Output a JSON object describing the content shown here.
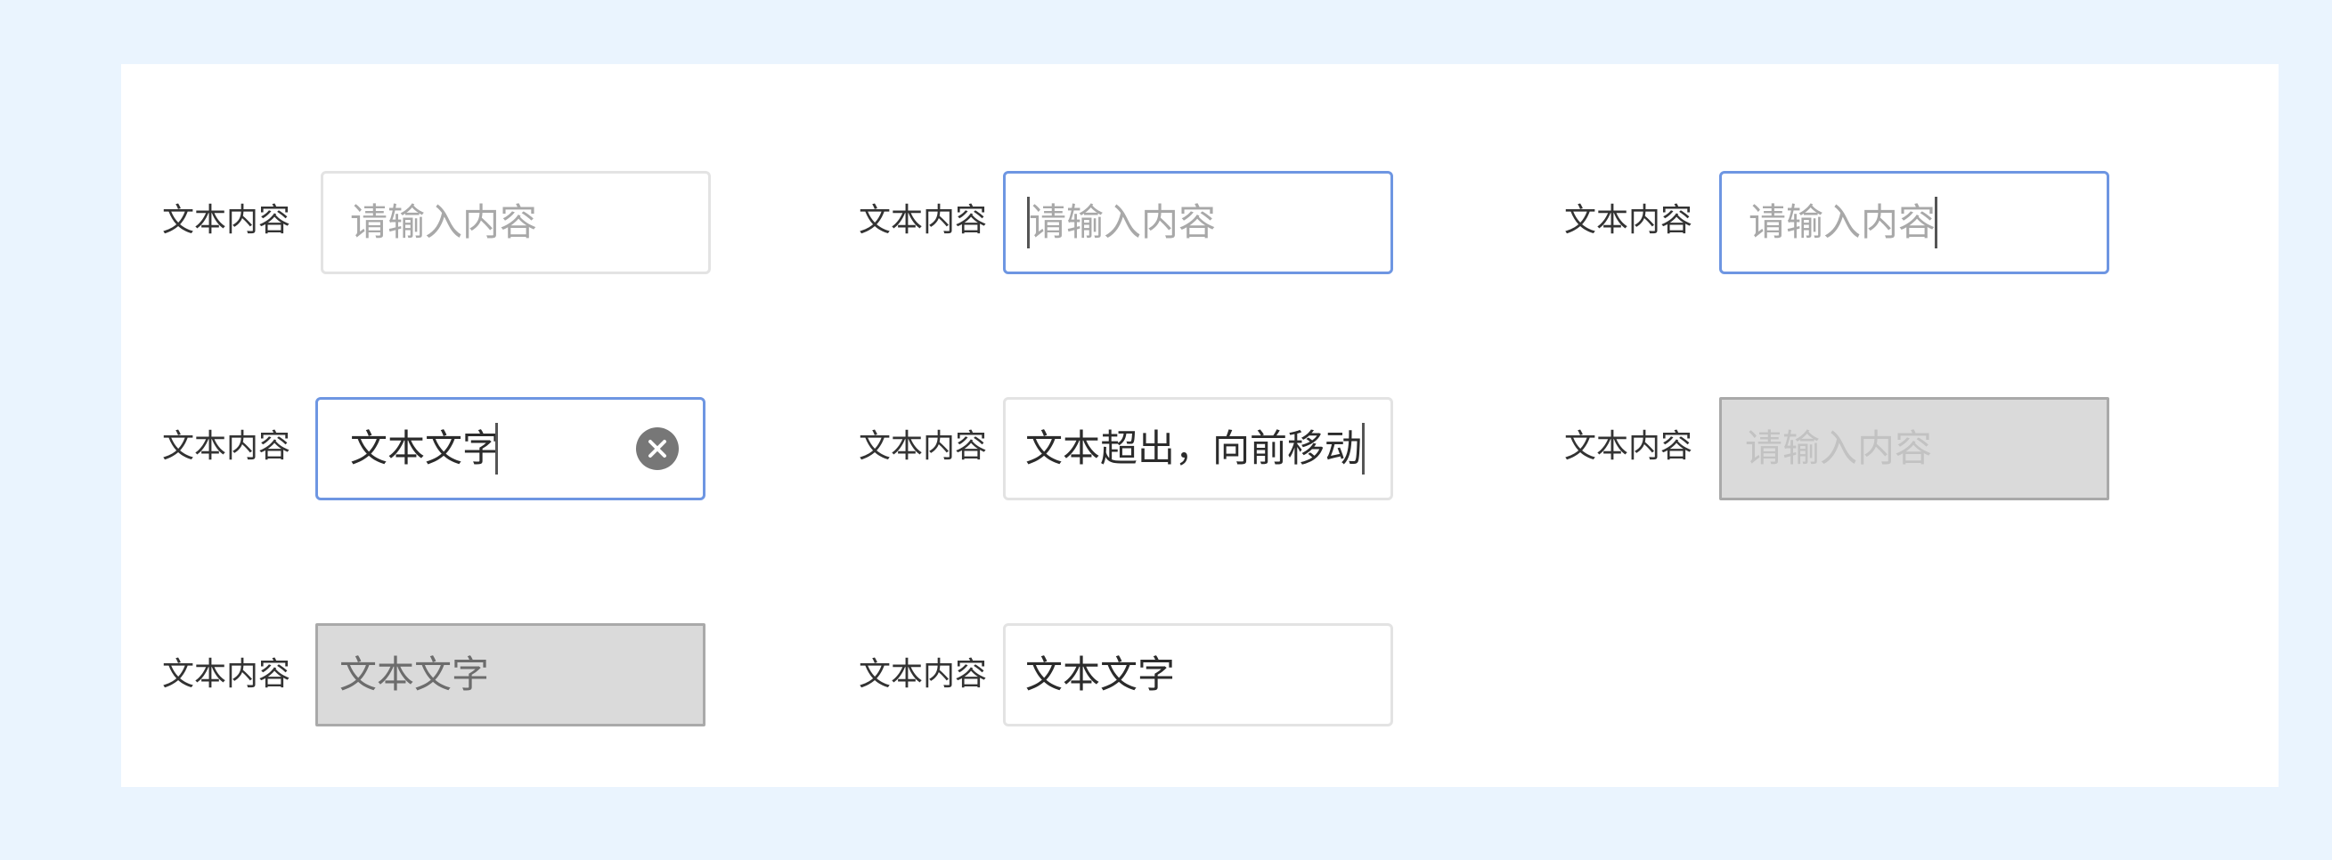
{
  "labels": {
    "r1c1": "文本内容",
    "r1c2": "文本内容",
    "r1c3": "文本内容",
    "r2c1": "文本内容",
    "r2c2": "文本内容",
    "r2c3": "文本内容",
    "r3c1": "文本内容",
    "r3c2": "文本内容"
  },
  "fields": {
    "default": {
      "placeholder": "请输入内容",
      "value": ""
    },
    "focused_caret_start": {
      "placeholder": "请输入内容",
      "value": ""
    },
    "focused_caret_end": {
      "placeholder": "请输入内容",
      "value": ""
    },
    "typing_with_clear": {
      "placeholder": "",
      "value": "文本文字"
    },
    "overflow": {
      "placeholder": "",
      "value": "文本超出，向前移动"
    },
    "disabled_empty": {
      "placeholder": "请输入内容",
      "value": ""
    },
    "disabled_filled": {
      "placeholder": "",
      "value": "文本文字"
    },
    "filled": {
      "placeholder": "",
      "value": "文本文字"
    }
  },
  "icons": {
    "clear": "clear-circle-icon"
  },
  "colors": {
    "page_bg": "#EAF4FE",
    "panel_bg": "#FFFFFF",
    "border_default": "#E3E3E3",
    "border_focus": "#6E96E2",
    "disabled_bg": "#DADADA",
    "placeholder": "#A8A8A8"
  }
}
